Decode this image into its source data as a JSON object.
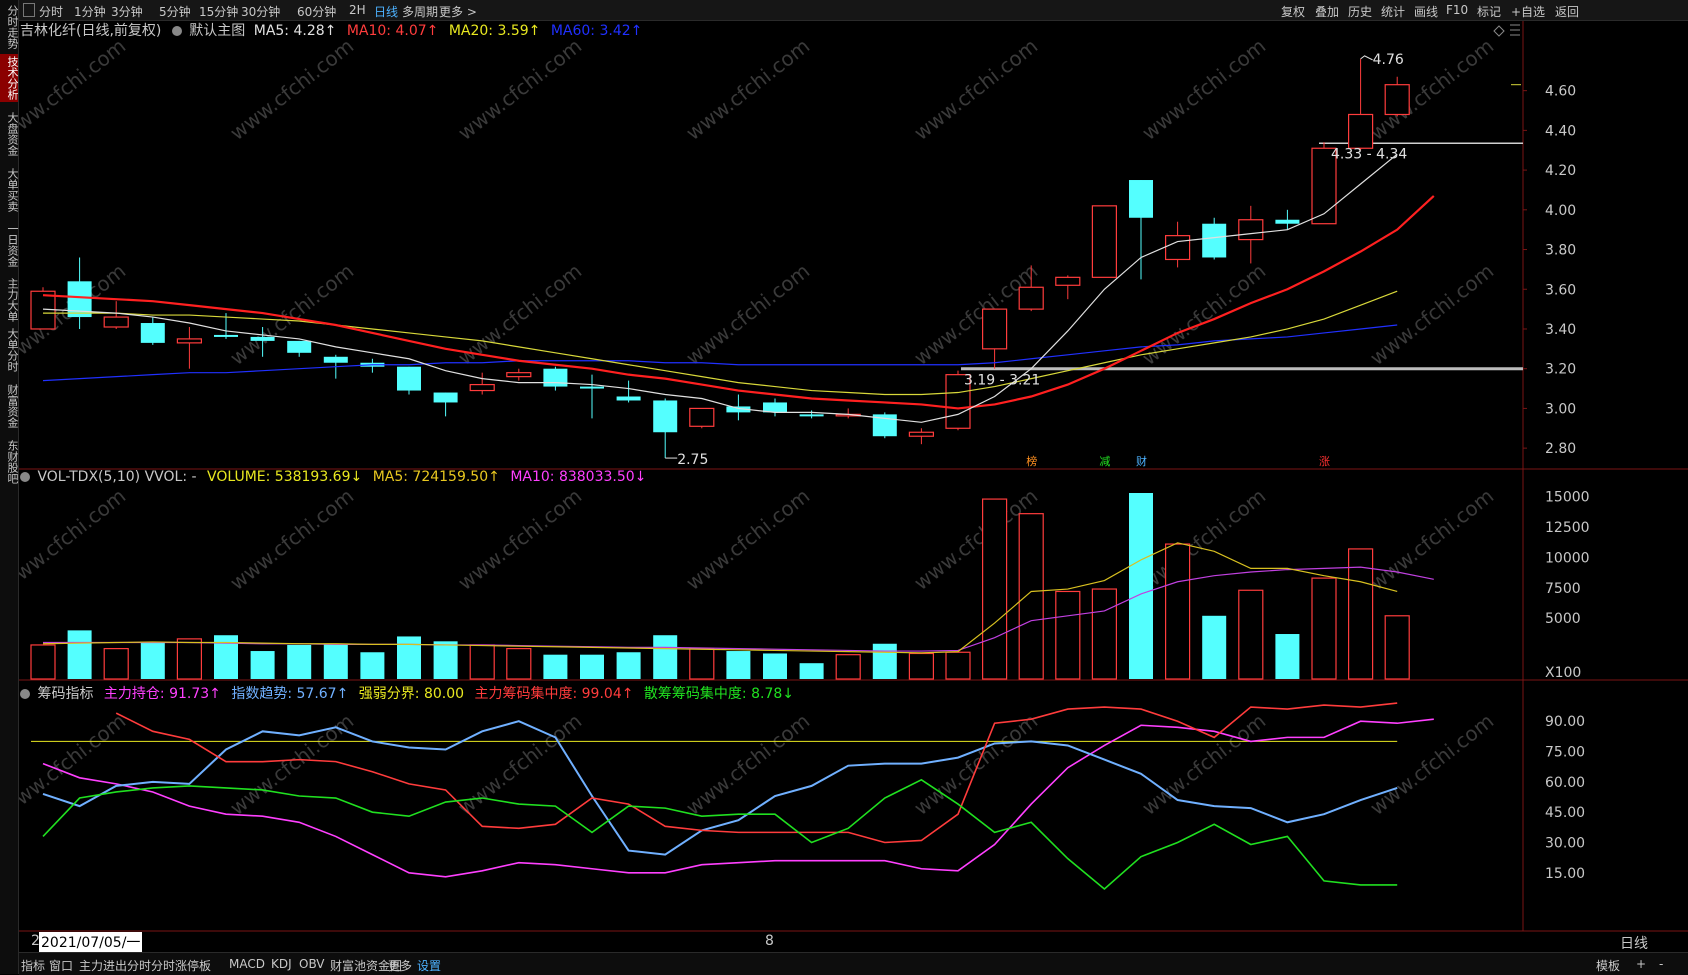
{
  "left_tabs": [
    "分时走势",
    "技术分析",
    "大盘资金",
    "大单买卖",
    "一日资金",
    "主力大单",
    "大单分时",
    "财富资金",
    "东财股吧"
  ],
  "left_active": 1,
  "toolbar": {
    "periods": [
      "分时",
      "1分钟",
      "3分钟",
      "5分钟",
      "15分钟",
      "30分钟",
      "60分钟",
      "2H",
      "日线",
      "多周期",
      "更多 >"
    ],
    "active_period": "日线",
    "right": [
      "复权",
      "叠加",
      "历史",
      "统计",
      "画线",
      "F10",
      "标记",
      "+自选",
      "返回"
    ]
  },
  "main_header": {
    "title": "吉林化纤(日线,前复权)",
    "template": "默认主图",
    "ma5": "MA5: 4.28↑",
    "ma10": "MA10: 4.07↑",
    "ma20": "MA20: 3.59↑",
    "ma60": "MA60: 3.42↑"
  },
  "vol_header": {
    "name": "VOL-TDX(5,10) VVOL: -",
    "volume": "VOLUME: 538193.69↓",
    "ma5": "MA5: 724159.50↑",
    "ma10": "MA10: 838033.50↓"
  },
  "chip_header": {
    "name": "筹码指标",
    "main_hold": "主力持仓: 91.73↑",
    "index_trend": "指数趋势: 57.67↑",
    "strength": "强弱分界: 80.00",
    "main_conc": "主力筹码集中度: 99.04↑",
    "retail_conc": "散筹筹码集中度: 8.78↓"
  },
  "annotations": {
    "high": "4.76",
    "low": "2.75",
    "range1": "3.19 - 3.21",
    "range2": "4.33 - 4.34",
    "markers": [
      "榜",
      "减",
      "财",
      "涨"
    ]
  },
  "axis_labels": {
    "price": [
      "4.60",
      "4.40",
      "4.20",
      "4.00",
      "3.80",
      "3.60",
      "3.40",
      "3.20",
      "3.00",
      "2.80"
    ],
    "volume": [
      "15000",
      "12500",
      "10000",
      "7500",
      "5000"
    ],
    "volume_unit": "X100",
    "chip": [
      "90.00",
      "75.00",
      "60.00",
      "45.00",
      "30.00",
      "15.00"
    ]
  },
  "bottom_axis": {
    "date": "2021/07/05/一",
    "mid": "8",
    "prefix": "2"
  },
  "period_tab": "日线",
  "bottom_tabs": [
    "指标",
    "窗口",
    "主力进出分时",
    "分时涨停板",
    "MACD",
    "KDJ",
    "OBV",
    "财富池资金图",
    "更多",
    "设置"
  ],
  "bottom_active": "设置",
  "bottom_right": "模板",
  "watermark": "www.cfchi.com",
  "colors": {
    "up": "#ff3c3c",
    "down": "#54ffff",
    "ma5": "#e0e0e0",
    "ma10": "#ff2020",
    "ma20": "#d8d83a",
    "ma60": "#2030ff",
    "violet": "#ff40ff",
    "blue": "#70b0ff",
    "green": "#20e020",
    "yellow": "#e8e820"
  },
  "chart_data": {
    "type": "candlestick",
    "ylim": [
      2.7,
      4.85
    ],
    "candles": [
      {
        "o": 3.4,
        "c": 3.59,
        "h": 3.61,
        "l": 3.4
      },
      {
        "o": 3.64,
        "c": 3.46,
        "h": 3.76,
        "l": 3.4
      },
      {
        "o": 3.41,
        "c": 3.46,
        "h": 3.54,
        "l": 3.4
      },
      {
        "o": 3.43,
        "c": 3.33,
        "h": 3.46,
        "l": 3.32
      },
      {
        "o": 3.33,
        "c": 3.35,
        "h": 3.41,
        "l": 3.2
      },
      {
        "o": 3.37,
        "c": 3.36,
        "h": 3.48,
        "l": 3.35
      },
      {
        "o": 3.36,
        "c": 3.34,
        "h": 3.41,
        "l": 3.26
      },
      {
        "o": 3.34,
        "c": 3.28,
        "h": 3.34,
        "l": 3.26
      },
      {
        "o": 3.26,
        "c": 3.23,
        "h": 3.27,
        "l": 3.15
      },
      {
        "o": 3.23,
        "c": 3.21,
        "h": 3.25,
        "l": 3.18
      },
      {
        "o": 3.21,
        "c": 3.09,
        "h": 3.21,
        "l": 3.07
      },
      {
        "o": 3.08,
        "c": 3.03,
        "h": 3.08,
        "l": 2.96
      },
      {
        "o": 3.09,
        "c": 3.12,
        "h": 3.18,
        "l": 3.07
      },
      {
        "o": 3.16,
        "c": 3.18,
        "h": 3.2,
        "l": 3.14
      },
      {
        "o": 3.2,
        "c": 3.11,
        "h": 3.21,
        "l": 3.09
      },
      {
        "o": 3.11,
        "c": 3.1,
        "h": 3.17,
        "l": 2.95
      },
      {
        "o": 3.06,
        "c": 3.04,
        "h": 3.14,
        "l": 3.03
      },
      {
        "o": 3.04,
        "c": 2.88,
        "h": 3.05,
        "l": 2.75
      },
      {
        "o": 2.91,
        "c": 3.0,
        "h": 3.0,
        "l": 2.9
      },
      {
        "o": 3.01,
        "c": 2.98,
        "h": 3.07,
        "l": 2.94
      },
      {
        "o": 3.03,
        "c": 2.98,
        "h": 3.05,
        "l": 2.96
      },
      {
        "o": 2.97,
        "c": 2.96,
        "h": 2.99,
        "l": 2.95
      },
      {
        "o": 2.97,
        "c": 2.97,
        "h": 3.0,
        "l": 2.95
      },
      {
        "o": 2.97,
        "c": 2.86,
        "h": 2.98,
        "l": 2.85
      },
      {
        "o": 2.86,
        "c": 2.88,
        "h": 2.9,
        "l": 2.82
      },
      {
        "o": 2.9,
        "c": 3.17,
        "h": 3.19,
        "l": 2.89
      },
      {
        "o": 3.3,
        "c": 3.5,
        "h": 3.5,
        "l": 3.2
      },
      {
        "o": 3.5,
        "c": 3.61,
        "h": 3.72,
        "l": 3.49
      },
      {
        "o": 3.62,
        "c": 3.66,
        "h": 3.67,
        "l": 3.55
      },
      {
        "o": 3.66,
        "c": 4.02,
        "h": 4.02,
        "l": 3.66
      },
      {
        "o": 4.15,
        "c": 3.96,
        "h": 4.15,
        "l": 3.65
      },
      {
        "o": 3.75,
        "c": 3.87,
        "h": 3.94,
        "l": 3.71
      },
      {
        "o": 3.93,
        "c": 3.76,
        "h": 3.96,
        "l": 3.75
      },
      {
        "o": 3.85,
        "c": 3.95,
        "h": 4.02,
        "l": 3.73
      },
      {
        "o": 3.95,
        "c": 3.93,
        "h": 4.0,
        "l": 3.9
      },
      {
        "o": 3.93,
        "c": 4.31,
        "h": 4.34,
        "l": 3.93
      },
      {
        "o": 4.31,
        "c": 4.48,
        "h": 4.76,
        "l": 4.3
      },
      {
        "o": 4.48,
        "c": 4.63,
        "h": 4.67,
        "l": 4.47
      }
    ],
    "ma5": [
      3.5,
      3.49,
      3.48,
      3.46,
      3.43,
      3.39,
      3.37,
      3.35,
      3.31,
      3.28,
      3.25,
      3.19,
      3.15,
      3.13,
      3.13,
      3.12,
      3.1,
      3.07,
      3.05,
      3.0,
      2.98,
      2.98,
      2.97,
      2.95,
      2.93,
      2.97,
      3.06,
      3.2,
      3.39,
      3.6,
      3.76,
      3.84,
      3.86,
      3.88,
      3.9,
      3.98,
      4.13,
      4.28
    ],
    "ma10": [
      3.57,
      3.56,
      3.55,
      3.54,
      3.52,
      3.5,
      3.48,
      3.45,
      3.42,
      3.38,
      3.34,
      3.3,
      3.27,
      3.24,
      3.22,
      3.2,
      3.17,
      3.15,
      3.12,
      3.09,
      3.07,
      3.05,
      3.04,
      3.03,
      3.02,
      3.0,
      3.02,
      3.06,
      3.12,
      3.2,
      3.29,
      3.38,
      3.45,
      3.53,
      3.6,
      3.69,
      3.79,
      3.9,
      4.07
    ],
    "ma20": [
      3.48,
      3.48,
      3.48,
      3.47,
      3.47,
      3.46,
      3.45,
      3.44,
      3.42,
      3.4,
      3.38,
      3.36,
      3.34,
      3.31,
      3.28,
      3.25,
      3.22,
      3.19,
      3.16,
      3.13,
      3.11,
      3.09,
      3.08,
      3.07,
      3.07,
      3.08,
      3.11,
      3.15,
      3.19,
      3.23,
      3.27,
      3.3,
      3.33,
      3.36,
      3.4,
      3.45,
      3.52,
      3.59
    ],
    "ma60": [
      3.14,
      3.15,
      3.16,
      3.17,
      3.18,
      3.18,
      3.19,
      3.2,
      3.21,
      3.22,
      3.22,
      3.23,
      3.23,
      3.24,
      3.24,
      3.24,
      3.24,
      3.23,
      3.23,
      3.22,
      3.22,
      3.22,
      3.22,
      3.22,
      3.22,
      3.22,
      3.23,
      3.25,
      3.27,
      3.29,
      3.31,
      3.32,
      3.34,
      3.35,
      3.36,
      3.38,
      3.4,
      3.42
    ],
    "volume": [
      2800,
      4000,
      2500,
      3000,
      3300,
      3600,
      2300,
      2800,
      2900,
      2200,
      3500,
      3100,
      2800,
      2500,
      2000,
      2000,
      2200,
      3600,
      2500,
      2300,
      2100,
      1300,
      2000,
      2900,
      2100,
      2200,
      14800,
      13600,
      7200,
      7400,
      15300,
      11100,
      5200,
      7300,
      3700,
      8300,
      10700,
      5200
    ],
    "vol_ma5": [
      2900,
      2950,
      3000,
      3050,
      3000,
      3000,
      2950,
      2900,
      2900,
      2850,
      2850,
      2800,
      2750,
      2700,
      2650,
      2600,
      2550,
      2500,
      2450,
      2400,
      2350,
      2300,
      2250,
      2200,
      2150,
      2250,
      4600,
      7200,
      7400,
      8100,
      9800,
      11200,
      10500,
      9100,
      9100,
      8500,
      8000,
      7200
    ],
    "vol_ma10": [
      3000,
      3000,
      3000,
      3000,
      3000,
      2950,
      2900,
      2900,
      2850,
      2850,
      2850,
      2800,
      2800,
      2750,
      2700,
      2650,
      2600,
      2600,
      2550,
      2500,
      2450,
      2400,
      2350,
      2300,
      2300,
      2350,
      3400,
      4800,
      5200,
      5600,
      7000,
      8000,
      8500,
      8800,
      9000,
      9100,
      9200,
      8800,
      8200
    ],
    "chip_main_hold": [
      69,
      62,
      59,
      55,
      48,
      44,
      43,
      40,
      33,
      24,
      15,
      13,
      16,
      20,
      19,
      17,
      15,
      15,
      19,
      20,
      21,
      21,
      21,
      21,
      17,
      16,
      29,
      49,
      67,
      78,
      88,
      87,
      85,
      80,
      82,
      82,
      90,
      89,
      91
    ],
    "chip_index_trend": [
      54,
      48,
      58,
      60,
      59,
      76,
      85,
      83,
      87,
      80,
      77,
      76,
      85,
      90,
      82,
      53,
      26,
      24,
      36,
      41,
      53,
      58,
      68,
      69,
      69,
      72,
      79,
      80,
      78,
      71,
      64,
      51,
      48,
      47,
      40,
      44,
      51,
      57
    ],
    "chip_main_conc": [
      94,
      85,
      81,
      70,
      70,
      71,
      70,
      65,
      59,
      56,
      38,
      37,
      39,
      52,
      49,
      38,
      36,
      35,
      35,
      35,
      35,
      30,
      31,
      44,
      89,
      91,
      96,
      97,
      96,
      90,
      82,
      97,
      96,
      98,
      97,
      99
    ],
    "chip_retail_conc": [
      33,
      52,
      55,
      57,
      58,
      57,
      56,
      53,
      52,
      45,
      43,
      50,
      52,
      49,
      48,
      35,
      48,
      47,
      43,
      44,
      44,
      30,
      37,
      52,
      61,
      49,
      35,
      40,
      22,
      7,
      23,
      30,
      39,
      29,
      33,
      11,
      9,
      9
    ],
    "chip_strength_line": 80
  }
}
